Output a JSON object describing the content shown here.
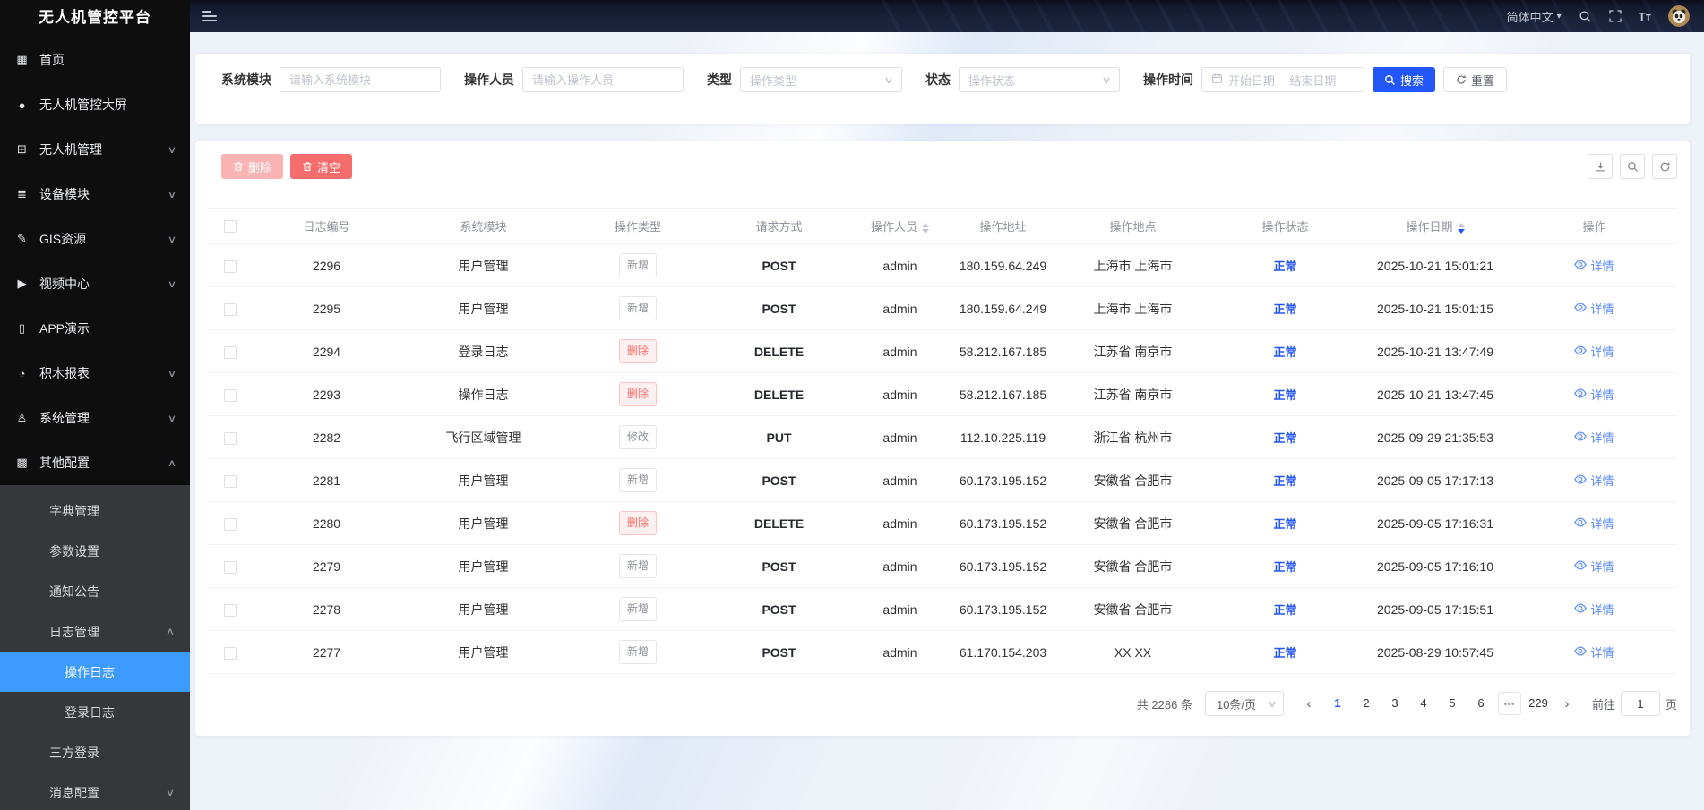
{
  "app": {
    "title": "无人机管控平台"
  },
  "topbar": {
    "language": "简体中文",
    "font_size_label": "Tт"
  },
  "sidebar": {
    "items": [
      {
        "name": "home",
        "label": "首页",
        "icon": "home-grid"
      },
      {
        "name": "big-screen",
        "label": "无人机管控大屏",
        "icon": "big-screen"
      },
      {
        "name": "drone-manage",
        "label": "无人机管理",
        "icon": "drone-manage",
        "chevron": "down"
      },
      {
        "name": "device-module",
        "label": "设备模块",
        "icon": "device-module",
        "chevron": "down"
      },
      {
        "name": "gis-resource",
        "label": "GIS资源",
        "icon": "gis-edit",
        "chevron": "down"
      },
      {
        "name": "video-center",
        "label": "视频中心",
        "icon": "video-center",
        "chevron": "down"
      },
      {
        "name": "app-demo",
        "label": "APP演示",
        "icon": "app-demo"
      },
      {
        "name": "block-report",
        "label": "积木报表",
        "icon": "block-report",
        "chevron": "down"
      },
      {
        "name": "system-manage",
        "label": "系统管理",
        "icon": "system-manage",
        "chevron": "down"
      },
      {
        "name": "other-config",
        "label": "其他配置",
        "icon": "other-config",
        "chevron": "up",
        "expanded": true,
        "children": [
          {
            "name": "dict-manage",
            "label": "字典管理"
          },
          {
            "name": "param-settings",
            "label": "参数设置"
          },
          {
            "name": "notice",
            "label": "通知公告"
          },
          {
            "name": "log-manage",
            "label": "日志管理",
            "chevron": "up",
            "expanded": true,
            "children": [
              {
                "name": "operation-log",
                "label": "操作日志",
                "active": true
              },
              {
                "name": "login-log",
                "label": "登录日志"
              }
            ]
          },
          {
            "name": "third-party-login",
            "label": "三方登录"
          },
          {
            "name": "message-config",
            "label": "消息配置",
            "chevron": "down"
          }
        ]
      }
    ]
  },
  "filters": {
    "module_label": "系统模块",
    "module_placeholder": "请输入系统模块",
    "operator_label": "操作人员",
    "operator_placeholder": "请输入操作人员",
    "type_label": "类型",
    "type_placeholder": "操作类型",
    "status_label": "状态",
    "status_placeholder": "操作状态",
    "time_label": "操作时间",
    "date_start_placeholder": "开始日期",
    "date_separator": "-",
    "date_end_placeholder": "结束日期",
    "search_label": "搜索",
    "reset_label": "重置"
  },
  "toolbar": {
    "delete_label": "删除",
    "delete_disabled": true,
    "clear_label": "清空",
    "icon_buttons": [
      "download",
      "search",
      "refresh"
    ]
  },
  "table": {
    "columns": [
      {
        "key": "checkbox",
        "label": ""
      },
      {
        "key": "id",
        "label": "日志编号"
      },
      {
        "key": "module",
        "label": "系统模块"
      },
      {
        "key": "type",
        "label": "操作类型"
      },
      {
        "key": "method",
        "label": "请求方式"
      },
      {
        "key": "operator",
        "label": "操作人员",
        "sortable": true
      },
      {
        "key": "ip",
        "label": "操作地址"
      },
      {
        "key": "location",
        "label": "操作地点"
      },
      {
        "key": "status",
        "label": "操作状态"
      },
      {
        "key": "date",
        "label": "操作日期",
        "sortable": true,
        "sort": "desc"
      },
      {
        "key": "action",
        "label": "操作"
      }
    ],
    "rows": [
      {
        "id": "2296",
        "module": "用户管理",
        "type": "新增",
        "type_kind": "default",
        "method": "POST",
        "operator": "admin",
        "ip": "180.159.64.249",
        "location": "上海市 上海市",
        "status": "正常",
        "date": "2025-10-21 15:01:21",
        "action": "详情"
      },
      {
        "id": "2295",
        "module": "用户管理",
        "type": "新增",
        "type_kind": "default",
        "method": "POST",
        "operator": "admin",
        "ip": "180.159.64.249",
        "location": "上海市 上海市",
        "status": "正常",
        "date": "2025-10-21 15:01:15",
        "action": "详情"
      },
      {
        "id": "2294",
        "module": "登录日志",
        "type": "删除",
        "type_kind": "danger",
        "method": "DELETE",
        "operator": "admin",
        "ip": "58.212.167.185",
        "location": "江苏省 南京市",
        "status": "正常",
        "date": "2025-10-21 13:47:49",
        "action": "详情"
      },
      {
        "id": "2293",
        "module": "操作日志",
        "type": "删除",
        "type_kind": "danger",
        "method": "DELETE",
        "operator": "admin",
        "ip": "58.212.167.185",
        "location": "江苏省 南京市",
        "status": "正常",
        "date": "2025-10-21 13:47:45",
        "action": "详情"
      },
      {
        "id": "2282",
        "module": "飞行区域管理",
        "type": "修改",
        "type_kind": "default",
        "method": "PUT",
        "operator": "admin",
        "ip": "112.10.225.119",
        "location": "浙江省 杭州市",
        "status": "正常",
        "date": "2025-09-29 21:35:53",
        "action": "详情"
      },
      {
        "id": "2281",
        "module": "用户管理",
        "type": "新增",
        "type_kind": "default",
        "method": "POST",
        "operator": "admin",
        "ip": "60.173.195.152",
        "location": "安徽省 合肥市",
        "status": "正常",
        "date": "2025-09-05 17:17:13",
        "action": "详情"
      },
      {
        "id": "2280",
        "module": "用户管理",
        "type": "删除",
        "type_kind": "danger",
        "method": "DELETE",
        "operator": "admin",
        "ip": "60.173.195.152",
        "location": "安徽省 合肥市",
        "status": "正常",
        "date": "2025-09-05 17:16:31",
        "action": "详情"
      },
      {
        "id": "2279",
        "module": "用户管理",
        "type": "新增",
        "type_kind": "default",
        "method": "POST",
        "operator": "admin",
        "ip": "60.173.195.152",
        "location": "安徽省 合肥市",
        "status": "正常",
        "date": "2025-09-05 17:16:10",
        "action": "详情"
      },
      {
        "id": "2278",
        "module": "用户管理",
        "type": "新增",
        "type_kind": "default",
        "method": "POST",
        "operator": "admin",
        "ip": "60.173.195.152",
        "location": "安徽省 合肥市",
        "status": "正常",
        "date": "2025-09-05 17:15:51",
        "action": "详情"
      },
      {
        "id": "2277",
        "module": "用户管理",
        "type": "新增",
        "type_kind": "default",
        "method": "POST",
        "operator": "admin",
        "ip": "61.170.154.203",
        "location": "XX XX",
        "status": "正常",
        "date": "2025-08-29 10:57:45",
        "action": "详情"
      }
    ]
  },
  "pagination": {
    "total_label": "共 2286 条",
    "page_size": "10条/页",
    "pages": [
      "1",
      "2",
      "3",
      "4",
      "5",
      "6",
      "•••",
      "229"
    ],
    "active_page": "1",
    "prev_label": "‹",
    "next_label": "›",
    "goto_label": "前往",
    "goto_value": "1",
    "goto_suffix": "页"
  },
  "colors": {
    "accent_blue": "#2356f6",
    "menu_active_blue": "#3d9aff",
    "danger_red": "#f56c6c",
    "link_blue": "#5a8bf8",
    "sidebar_black": "#0e0e0e",
    "submenu_gray": "#35373a",
    "topbar_navy": "#1a2138"
  }
}
